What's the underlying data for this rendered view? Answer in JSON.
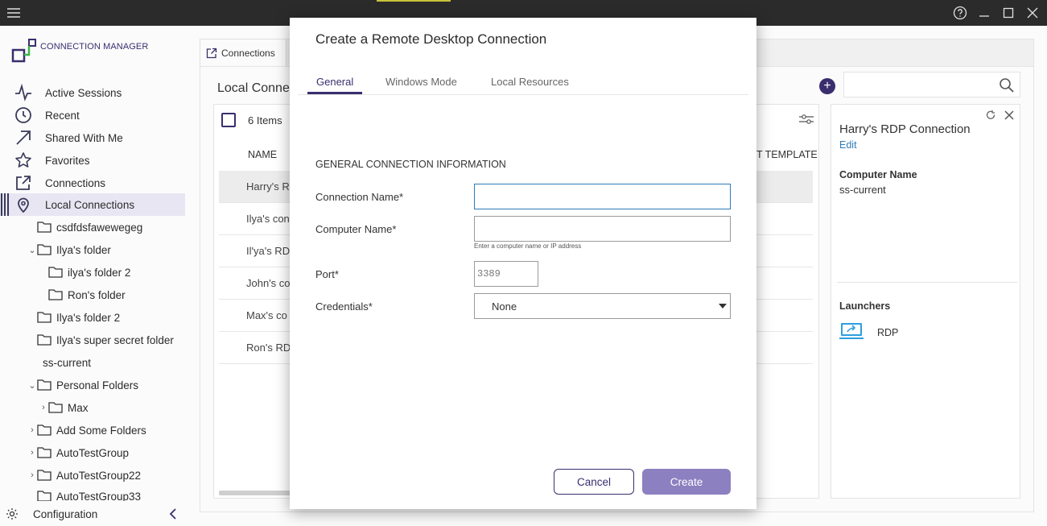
{
  "app": {
    "brand": "CONNECTION MANAGER",
    "colors": {
      "accent": "#3a2e6e",
      "green": "#3bb54a",
      "titlebar": "#2b2b2b"
    }
  },
  "sidebar": {
    "nav": [
      {
        "label": "Active Sessions",
        "icon": "activity-icon"
      },
      {
        "label": "Recent",
        "icon": "clock-icon"
      },
      {
        "label": "Shared With Me",
        "icon": "arrow-up-right-icon"
      },
      {
        "label": "Favorites",
        "icon": "star-icon"
      },
      {
        "label": "Connections",
        "icon": "external-link-icon"
      },
      {
        "label": "Local Connections",
        "icon": "map-pin-icon"
      }
    ],
    "tree": [
      {
        "label": "csdfdsfawewegeg",
        "type": "folder"
      },
      {
        "label": "Ilya's folder",
        "type": "folder",
        "expanded": true
      },
      {
        "label": "ilya's folder 2",
        "type": "folder"
      },
      {
        "label": "Ron's folder",
        "type": "folder"
      },
      {
        "label": "Ilya's folder 2",
        "type": "folder"
      },
      {
        "label": "Ilya's super secret folder",
        "type": "folder"
      },
      {
        "label": "ss-current",
        "type": "connection"
      },
      {
        "label": "Personal Folders",
        "type": "folder",
        "expanded": true
      },
      {
        "label": "Max",
        "type": "folder"
      },
      {
        "label": "Add Some Folders",
        "type": "folder"
      },
      {
        "label": "AutoTestGroup",
        "type": "folder"
      },
      {
        "label": "AutoTestGroup22",
        "type": "folder"
      },
      {
        "label": "AutoTestGroup33",
        "type": "folder"
      }
    ],
    "footer_label": "Configuration"
  },
  "main": {
    "tab_label": "Connections",
    "heading": "Local Connec",
    "items_count": "6 Items",
    "col_name": "NAME",
    "col_template": "T TEMPLATE",
    "rows": [
      "Harry's R",
      "Ilya's con",
      "Il'ya's RDP",
      "John's co",
      "Max's co",
      "Ron's RDP"
    ]
  },
  "details": {
    "title": "Harry's RDP Connection",
    "edit_label": "Edit",
    "computer_name_label": "Computer Name",
    "computer_name_value": "ss-current",
    "launchers_label": "Launchers",
    "launcher_rdp": "RDP"
  },
  "modal": {
    "title": "Create a Remote Desktop Connection",
    "tabs": [
      "General",
      "Windows Mode",
      "Local Resources"
    ],
    "active_tab": "General",
    "section_title": "GENERAL CONNECTION INFORMATION",
    "fields": {
      "connection_name_label": "Connection Name*",
      "connection_name_value": "",
      "computer_name_label": "Computer Name*",
      "computer_name_value": "",
      "computer_name_hint": "Enter a computer name or IP address",
      "port_label": "Port*",
      "port_placeholder": "3389",
      "credentials_label": "Credentials*",
      "credentials_value": "None"
    },
    "cancel_label": "Cancel",
    "create_label": "Create"
  }
}
